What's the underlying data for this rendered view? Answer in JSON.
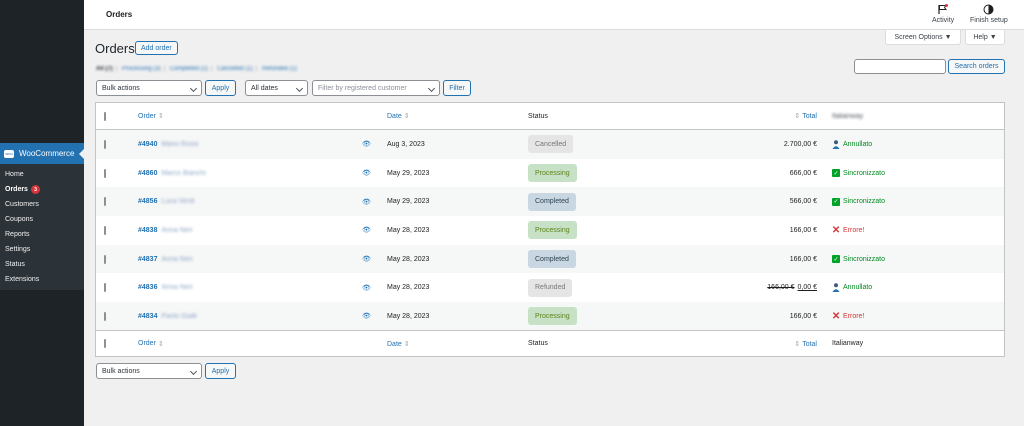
{
  "sidebar": {
    "menu_label": "WooCommerce",
    "items": [
      {
        "label": "Home"
      },
      {
        "label": "Orders",
        "badge": "3"
      },
      {
        "label": "Customers"
      },
      {
        "label": "Coupons"
      },
      {
        "label": "Reports"
      },
      {
        "label": "Settings"
      },
      {
        "label": "Status"
      },
      {
        "label": "Extensions"
      }
    ]
  },
  "topbar": {
    "title": "Orders",
    "activity_label": "Activity",
    "finish_setup_label": "Finish setup"
  },
  "screen_options_label": "Screen Options ▼",
  "help_label": "Help ▼",
  "page": {
    "title": "Orders",
    "add_label": "Add order"
  },
  "views": [
    "All (7)",
    "Processing (3)",
    "Completed (2)",
    "Cancelled (1)",
    "Refunded (1)"
  ],
  "search": {
    "value": "",
    "button_label": "Search orders"
  },
  "filters": {
    "bulk_actions": "Bulk actions",
    "apply_label": "Apply",
    "dates": "All dates",
    "customer_placeholder": "Filter by registered customer",
    "filter_label": "Filter"
  },
  "table": {
    "headers": {
      "order": "Order",
      "date": "Date",
      "status": "Status",
      "total": "Total",
      "extra": "Italianway",
      "sort_glyph": "⇕"
    },
    "footers": {
      "order": "Order",
      "date": "Date",
      "status": "Status",
      "total": "Total",
      "extra": "Italianway"
    },
    "preview_glyph": "👁",
    "rows": [
      {
        "order": "#4940",
        "name": "Mario Rossi",
        "date": "Aug 3, 2023",
        "status": "Cancelled",
        "status_bg": "#e5e5e5",
        "status_fg": "#777777",
        "total": "2.700,00 €",
        "extra_icon": "person",
        "extra_label": "Annullato",
        "extra_color": "#008a20"
      },
      {
        "order": "#4860",
        "name": "Marco Bianchi",
        "date": "May 29, 2023",
        "status": "Processing",
        "status_bg": "#c6e1c6",
        "status_fg": "#5b841b",
        "total": "666,00 €",
        "extra_icon": "check",
        "extra_label": "Sincronizzato",
        "extra_color": "#008a20"
      },
      {
        "order": "#4856",
        "name": "Luca Verdi",
        "date": "May 29, 2023",
        "status": "Completed",
        "status_bg": "#c8d7e1",
        "status_fg": "#2e4453",
        "total": "566,00 €",
        "extra_icon": "check",
        "extra_label": "Sincronizzato",
        "extra_color": "#008a20"
      },
      {
        "order": "#4838",
        "name": "Anna Neri",
        "date": "May 28, 2023",
        "status": "Processing",
        "status_bg": "#c6e1c6",
        "status_fg": "#5b841b",
        "total": "166,00 €",
        "extra_icon": "cross",
        "extra_label": "Errore!",
        "extra_color": "#d63638"
      },
      {
        "order": "#4837",
        "name": "Anna Neri",
        "date": "May 28, 2023",
        "status": "Completed",
        "status_bg": "#c8d7e1",
        "status_fg": "#2e4453",
        "total": "166,00 €",
        "extra_icon": "check",
        "extra_label": "Sincronizzato",
        "extra_color": "#008a20"
      },
      {
        "order": "#4836",
        "name": "Anna Neri",
        "date": "May 28, 2023",
        "status": "Refunded",
        "status_bg": "#e5e5e5",
        "status_fg": "#777777",
        "total_old": "166,00 €",
        "total": "0,00 €",
        "extra_icon": "person",
        "extra_label": "Annullato",
        "extra_color": "#008a20"
      },
      {
        "order": "#4834",
        "name": "Paolo Gialli",
        "date": "May 28, 2023",
        "status": "Processing",
        "status_bg": "#c6e1c6",
        "status_fg": "#5b841b",
        "total": "166,00 €",
        "extra_icon": "cross",
        "extra_label": "Errore!",
        "extra_color": "#d63638"
      }
    ]
  },
  "colors": {
    "accent": "#2271b1",
    "sidebar_bg": "#1d2327",
    "badge": "#d63638"
  }
}
